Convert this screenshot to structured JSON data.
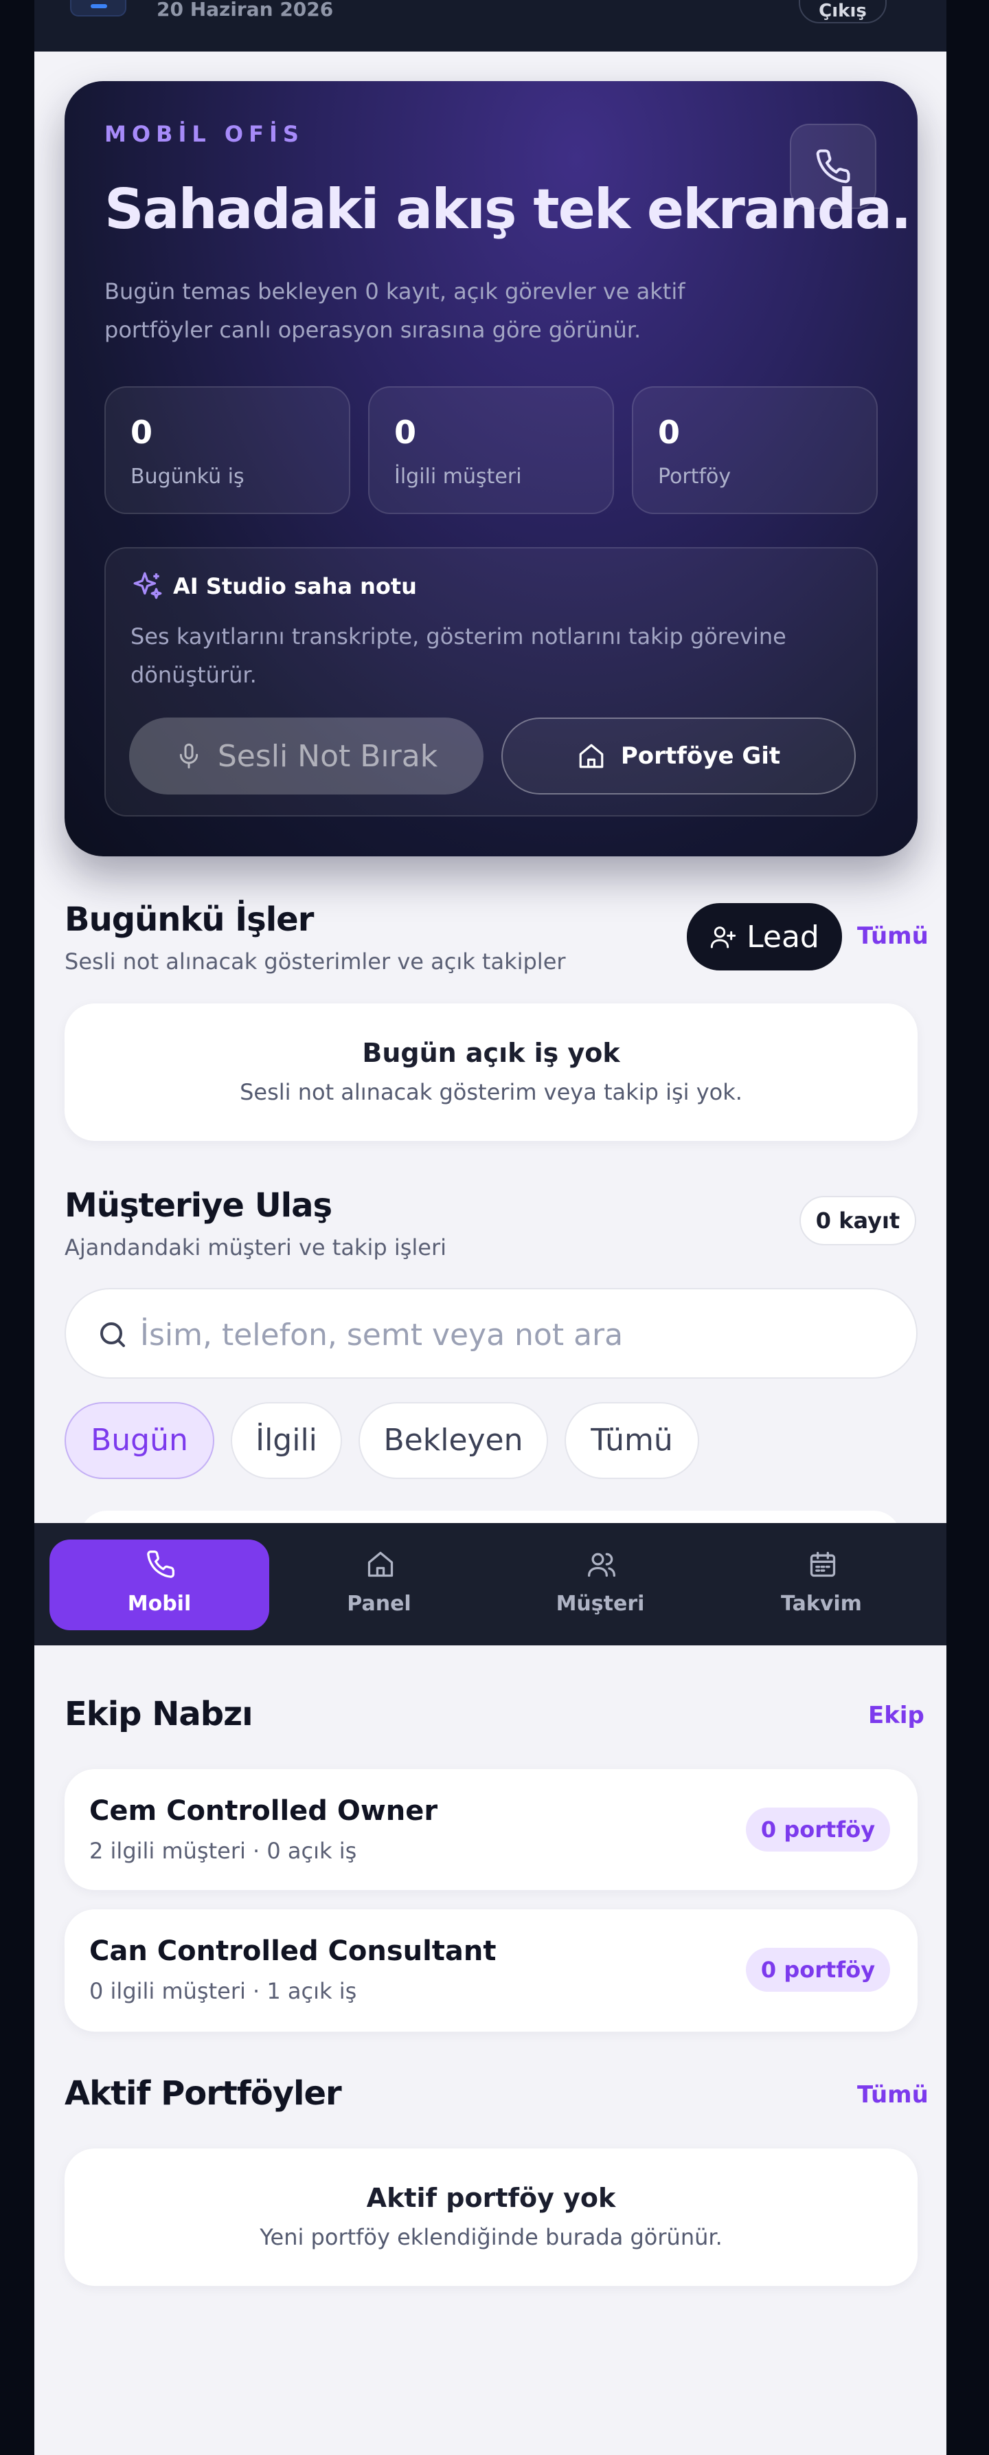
{
  "topbar": {
    "date": "20 Haziran 2026",
    "logout_label": "Çıkış"
  },
  "hero": {
    "kicker": "MOBİL OFİS",
    "headline": "Sahadaki akış tek ekranda.",
    "description": "Bugün temas bekleyen 0 kayıt, açık görevler ve aktif portföyler canlı operasyon sırasına göre görünür.",
    "stats": [
      {
        "value": "0",
        "label": "Bugünkü iş"
      },
      {
        "value": "0",
        "label": "İlgili müşteri"
      },
      {
        "value": "0",
        "label": "Portföy"
      }
    ],
    "ai": {
      "title": "AI Studio saha notu",
      "text": "Ses kayıtlarını transkripte, gösterim notlarını takip görevine dönüştürür.",
      "voice_button": "Sesli Not Bırak",
      "portfolio_button": "Portföye Git"
    }
  },
  "today": {
    "title": "Bugünkü İşler",
    "subtitle": "Sesli not alınacak gösterimler ve açık takipler",
    "lead_button": "Lead",
    "all_link": "Tümü",
    "empty_title": "Bugün açık iş yok",
    "empty_sub": "Sesli not alınacak gösterim veya takip işi yok."
  },
  "contact": {
    "title": "Müşteriye Ulaş",
    "subtitle": "Ajandandaki müşteri ve takip işleri",
    "count_badge": "0 kayıt",
    "search_placeholder": "İsim, telefon, semt veya not ara",
    "search_value": "",
    "filters": [
      "Bugün",
      "İlgili",
      "Bekleyen",
      "Tümü"
    ],
    "active_filter": "Bugün"
  },
  "nav": {
    "items": [
      {
        "label": "Mobil",
        "icon": "phone-icon",
        "active": true
      },
      {
        "label": "Panel",
        "icon": "home-icon",
        "active": false
      },
      {
        "label": "Müşteri",
        "icon": "users-icon",
        "active": false
      },
      {
        "label": "Takvim",
        "icon": "calendar-icon",
        "active": false
      }
    ]
  },
  "team": {
    "title": "Ekip Nabzı",
    "link": "Ekip",
    "members": [
      {
        "name": "Cem Controlled Owner",
        "meta": "2 ilgili müşteri · 0 açık iş",
        "badge": "0 portföy"
      },
      {
        "name": "Can Controlled Consultant",
        "meta": "0 ilgili müşteri · 1 açık iş",
        "badge": "0 portföy"
      }
    ]
  },
  "portfolios": {
    "title": "Aktif Portföyler",
    "link": "Tümü",
    "empty_title": "Aktif portföy yok",
    "empty_sub": "Yeni portföy eklendiğinde burada görünür."
  },
  "colors": {
    "accent": "#7c3aed",
    "dark": "#101322",
    "background": "#f3f3f8"
  }
}
